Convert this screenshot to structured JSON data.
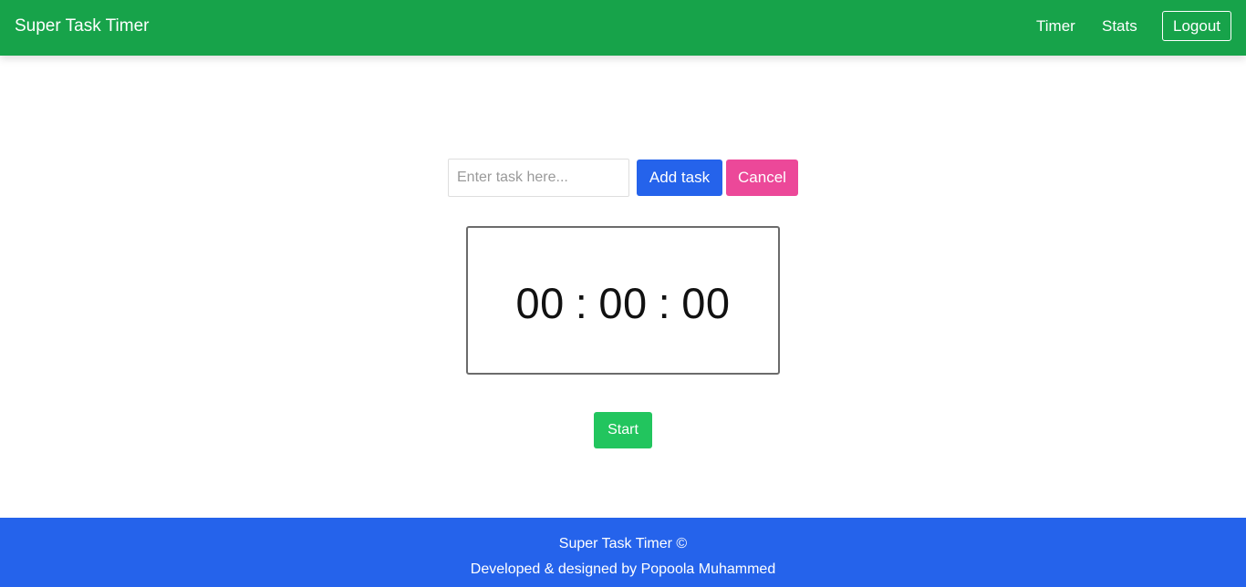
{
  "navbar": {
    "brand": "Super Task Timer",
    "links": [
      {
        "label": "Timer"
      },
      {
        "label": "Stats"
      }
    ],
    "logout_label": "Logout"
  },
  "task_form": {
    "input_value": "",
    "input_placeholder": "Enter task here...",
    "add_label": "Add task",
    "cancel_label": "Cancel"
  },
  "timer": {
    "hours": "00",
    "minutes": "00",
    "seconds": "00",
    "separator": ":"
  },
  "start_label": "Start",
  "footer": {
    "line1": "Super Task Timer ©",
    "line2": "Developed & designed by Popoola Muhammed"
  },
  "colors": {
    "navbar": "#17a34a",
    "add_button": "#2563eb",
    "cancel_button": "#ec4899",
    "start_button": "#22c55e",
    "footer": "#2563eb"
  }
}
